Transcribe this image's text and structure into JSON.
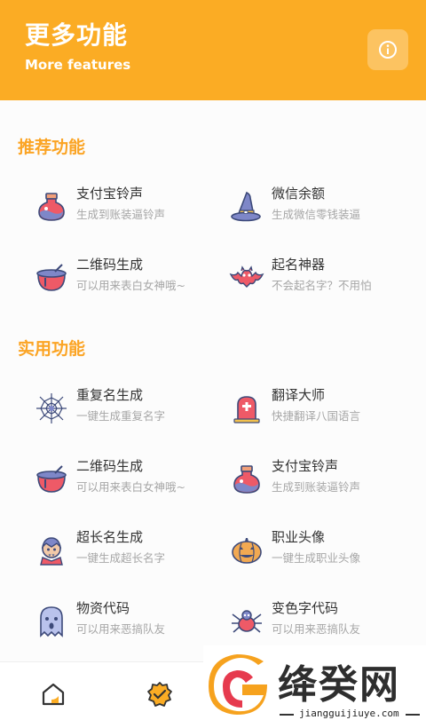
{
  "header": {
    "title": "更多功能",
    "subtitle": "More features",
    "info_icon": "info-icon"
  },
  "sections": [
    {
      "title": "推荐功能",
      "items": [
        {
          "title": "支付宝铃声",
          "subtitle": "生成到账装逼铃声",
          "icon": "potion-icon"
        },
        {
          "title": "微信余额",
          "subtitle": "生成微信零钱装逼",
          "icon": "witch-hat-icon"
        },
        {
          "title": "二维码生成",
          "subtitle": "可以用来表白女神哦~",
          "icon": "cauldron-icon"
        },
        {
          "title": "起名神器",
          "subtitle": "不会起名字？不用怕",
          "icon": "bat-icon"
        }
      ]
    },
    {
      "title": "实用功能",
      "items": [
        {
          "title": "重复名生成",
          "subtitle": "一键生成重复名字",
          "icon": "spiderweb-icon"
        },
        {
          "title": "翻译大师",
          "subtitle": "快捷翻译八国语言",
          "icon": "tombstone-icon"
        },
        {
          "title": "二维码生成",
          "subtitle": "可以用来表白女神哦~",
          "icon": "cauldron-icon"
        },
        {
          "title": "支付宝铃声",
          "subtitle": "生成到账装逼铃声",
          "icon": "potion-icon"
        },
        {
          "title": "超长名生成",
          "subtitle": "一键生成超长名字",
          "icon": "vampire-icon"
        },
        {
          "title": "职业头像",
          "subtitle": "一键生成职业头像",
          "icon": "pumpkin-icon"
        },
        {
          "title": "物资代码",
          "subtitle": "可以用来恶搞队友",
          "icon": "ghost-icon"
        },
        {
          "title": "变色字代码",
          "subtitle": "可以用来恶搞队友",
          "icon": "spider-icon"
        }
      ]
    }
  ],
  "tabbar": {
    "tabs": [
      {
        "icon": "home-icon"
      },
      {
        "icon": "badge-check-icon"
      }
    ]
  },
  "watermark": {
    "name": "绛癸网",
    "url": "jiangguijiuye.com"
  },
  "colors": {
    "brand": "#fbac24",
    "section_title": "#fba424",
    "icon_outline": "#3d4a7a"
  }
}
